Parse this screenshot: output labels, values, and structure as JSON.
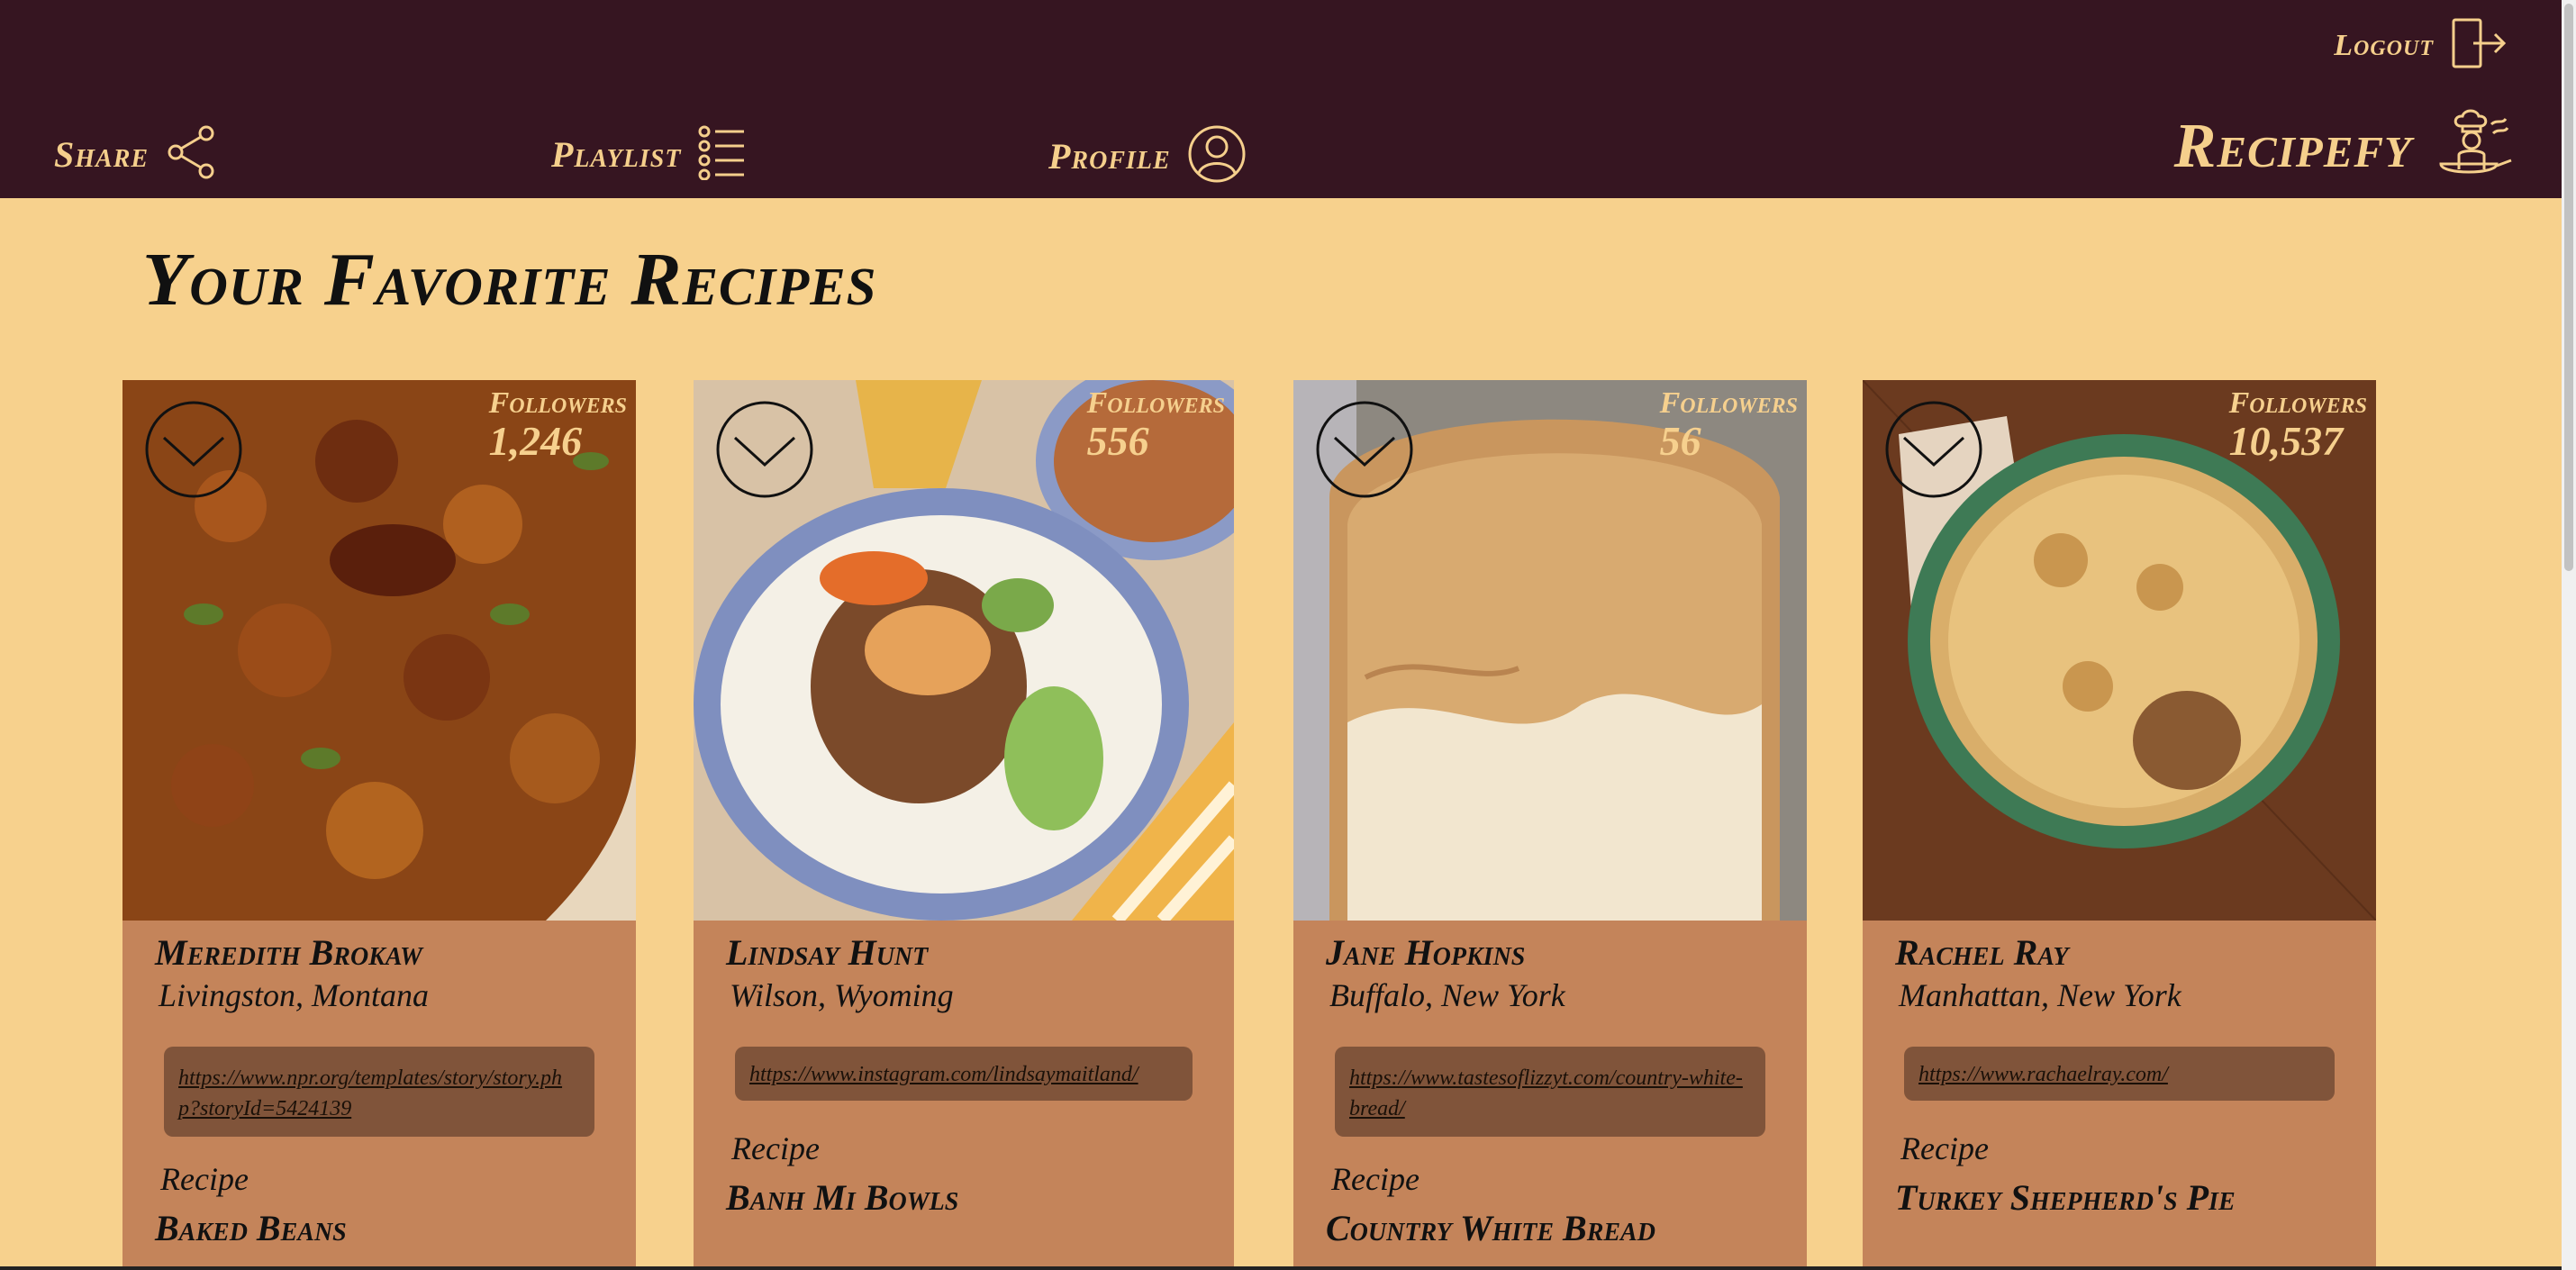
{
  "header": {
    "logout_label": "Logout",
    "nav": [
      {
        "label": "Share",
        "icon": "share-icon"
      },
      {
        "label": "Playlist",
        "icon": "list-icon"
      },
      {
        "label": "Profile",
        "icon": "user-circle-icon"
      }
    ],
    "brand": "Recipefy",
    "brand_icon": "chef-cooking-icon"
  },
  "page_title": "Your Favorite Recipes",
  "cards": [
    {
      "name": "Meredith Brokaw",
      "location": "Livingston, Montana",
      "followers_label": "Followers",
      "followers": "1,246",
      "link": "https://www.npr.org/templates/story/story.php?storyId=5424139",
      "recipe_label": "Recipe",
      "recipe": "Baked Beans",
      "image": "baked-beans-photo"
    },
    {
      "name": "Lindsay Hunt",
      "location": "Wilson, Wyoming",
      "followers_label": "Followers",
      "followers": "556",
      "link": "https://www.instagram.com/lindsaymaitland/",
      "recipe_label": "Recipe",
      "recipe": "Banh Mi Bowls",
      "image": "banh-mi-bowl-photo"
    },
    {
      "name": "Jane Hopkins",
      "location": "Buffalo, New York",
      "followers_label": "Followers",
      "followers": "56",
      "link": "https://www.tastesoflizzyt.com/country-white-bread/",
      "recipe_label": "Recipe",
      "recipe": "Country White Bread",
      "image": "white-bread-photo"
    },
    {
      "name": "Rachel Ray",
      "location": "Manhattan, New York",
      "followers_label": "Followers",
      "followers": "10,537",
      "link": "https://www.rachaelray.com/",
      "recipe_label": "Recipe",
      "recipe": "Turkey Shepherd's Pie",
      "image": "shepherds-pie-photo"
    }
  ],
  "colors": {
    "header_bg": "#361521",
    "page_bg": "#f7d18d",
    "card_bg": "#c4845a",
    "link_box_bg": "#80543a",
    "accent_text": "#f5cf8c"
  }
}
